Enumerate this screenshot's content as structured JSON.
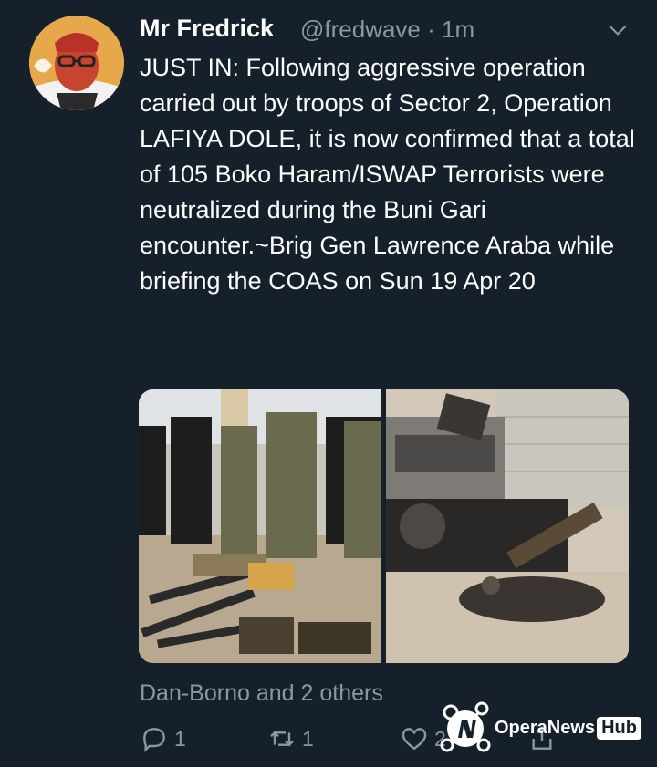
{
  "tweet": {
    "author_name": "Mr Fredrick",
    "handle_time": "@fredwave · 1m",
    "text": "JUST IN: Following aggressive operation carried out by troops of Sector 2, Operation LAFIYA DOLE, it is now confirmed that a total of 105 Boko Haram/ISWAP Terrorists were neutralized during the Buni Gari encounter.~Brig Gen Lawrence Araba while briefing the COAS on Sun 19 Apr 20",
    "liked_by": "Dan-Borno and 2 others",
    "reply_count": "1",
    "retweet_count": "1",
    "like_count": "2"
  },
  "icons": {
    "menu": "chevron-down-icon",
    "reply": "reply-icon",
    "retweet": "retweet-icon",
    "like": "heart-icon",
    "share": "share-icon"
  },
  "watermark": {
    "brand": "OperaNews",
    "hub": "Hub"
  },
  "colors": {
    "background": "#15202b",
    "secondary_text": "#8899a6"
  }
}
